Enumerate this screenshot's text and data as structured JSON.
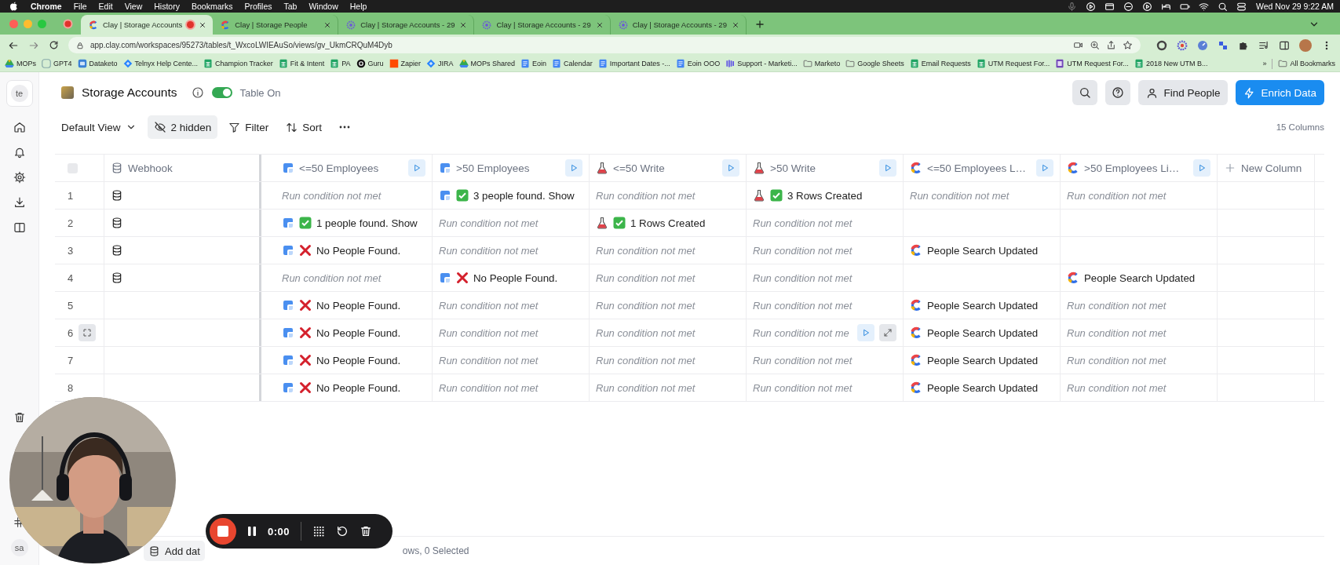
{
  "menu_bar": {
    "items": [
      "Chrome",
      "File",
      "Edit",
      "View",
      "History",
      "Bookmarks",
      "Profiles",
      "Tab",
      "Window",
      "Help"
    ],
    "clock": "Wed Nov 29  9:22 AM"
  },
  "browser_tabs": [
    {
      "title": "Clay | Storage Accounts",
      "kind": "clay",
      "selected": true,
      "recording": true
    },
    {
      "title": "Clay | Storage People",
      "kind": "clay",
      "selected": false,
      "recording": false
    },
    {
      "title": "Clay | Storage Accounts - 29",
      "kind": "gear",
      "selected": false,
      "recording": false
    },
    {
      "title": "Clay | Storage Accounts - 29",
      "kind": "gear",
      "selected": false,
      "recording": false
    },
    {
      "title": "Clay | Storage Accounts - 29",
      "kind": "gear",
      "selected": false,
      "recording": false
    }
  ],
  "address_bar": {
    "url": "app.clay.com/workspaces/95273/tables/t_WxcoLWIEAuSo/views/gv_UkmCRQuM4Dyb"
  },
  "bookmarks": [
    {
      "label": "MOPs",
      "kind": "drive"
    },
    {
      "label": "GPT4",
      "kind": "gpt"
    },
    {
      "label": "Dataketo",
      "kind": "dk"
    },
    {
      "label": "Telnyx Help Cente...",
      "kind": "jira"
    },
    {
      "label": "Champion Tracker",
      "kind": "sheet"
    },
    {
      "label": "Fit & Intent",
      "kind": "sheet"
    },
    {
      "label": "PA",
      "kind": "sheet"
    },
    {
      "label": "Guru",
      "kind": "guru"
    },
    {
      "label": "Zapier",
      "kind": "zapier"
    },
    {
      "label": "JIRA",
      "kind": "jira"
    },
    {
      "label": "MOPs Shared",
      "kind": "drive"
    },
    {
      "label": "Eoin",
      "kind": "doc"
    },
    {
      "label": "Calendar",
      "kind": "doc"
    },
    {
      "label": "Important Dates -...",
      "kind": "doc"
    },
    {
      "label": "Eoin OOO",
      "kind": "doc"
    },
    {
      "label": "Support - Marketi...",
      "kind": "bars"
    },
    {
      "label": "Marketo",
      "kind": "folder"
    },
    {
      "label": "Google Sheets",
      "kind": "folder"
    },
    {
      "label": "Email Requests",
      "kind": "sheet"
    },
    {
      "label": "UTM Request For...",
      "kind": "sheet"
    },
    {
      "label": "UTM Request For...",
      "kind": "form"
    },
    {
      "label": "2018 New UTM B...",
      "kind": "sheet"
    }
  ],
  "bookmarks_more": "»",
  "all_bookmarks": "All Bookmarks",
  "sidebar": {
    "workspace_avatar": "te",
    "user_avatar": "sa"
  },
  "table": {
    "title": "Storage Accounts",
    "toggle": {
      "label": "Table On",
      "on": true
    }
  },
  "header_actions": [
    {
      "label": "Find People",
      "kind": "secondary"
    },
    {
      "label": "Enrich Data",
      "kind": "primary"
    }
  ],
  "view_bar": {
    "view": "Default View",
    "hidden": "2 hidden",
    "filter": "Filter",
    "sort": "Sort",
    "column_count": "15 Columns"
  },
  "select_all": {
    "checked": false
  },
  "columns": [
    {
      "title": "Webhook",
      "kind": "webhook",
      "run_button": false
    },
    {
      "title": "<=50 Employees",
      "kind": "people",
      "run_button": true
    },
    {
      "title": ">50 Employees",
      "kind": "people",
      "run_button": true
    },
    {
      "title": "<=50 Write",
      "kind": "write",
      "run_button": true
    },
    {
      "title": ">50 Write",
      "kind": "write",
      "run_button": true
    },
    {
      "title": "<=50 Employees L…",
      "kind": "lookup",
      "run_button": true
    },
    {
      "title": ">50 Employees Li…",
      "kind": "lookup",
      "run_button": true
    },
    {
      "title": "New Column",
      "kind": "add",
      "run_button": false
    }
  ],
  "rows": [
    {
      "number": "1",
      "hovered": false,
      "cells": [
        {
          "kind": "record"
        },
        {
          "kind": "muted",
          "text": "Run condition not met"
        },
        {
          "kind": "people_found",
          "text": "3 people found. Show"
        },
        {
          "kind": "muted",
          "text": "Run condition not met"
        },
        {
          "kind": "rows_created",
          "text": "3 Rows Created"
        },
        {
          "kind": "muted",
          "text": "Run condition not met"
        },
        {
          "kind": "muted",
          "text": "Run condition not met"
        }
      ]
    },
    {
      "number": "2",
      "hovered": false,
      "cells": [
        {
          "kind": "record"
        },
        {
          "kind": "people_found",
          "text": "1 people found. Show"
        },
        {
          "kind": "muted",
          "text": "Run condition not met"
        },
        {
          "kind": "rows_created",
          "text": "1 Rows Created"
        },
        {
          "kind": "muted",
          "text": "Run condition not met"
        },
        {
          "kind": "empty"
        },
        {
          "kind": "empty"
        }
      ]
    },
    {
      "number": "3",
      "hovered": false,
      "cells": [
        {
          "kind": "record"
        },
        {
          "kind": "no_people",
          "text": "No People Found."
        },
        {
          "kind": "muted",
          "text": "Run condition not met"
        },
        {
          "kind": "muted",
          "text": "Run condition not met"
        },
        {
          "kind": "muted",
          "text": "Run condition not met"
        },
        {
          "kind": "search_updated",
          "text": "People Search Updated"
        },
        {
          "kind": "empty"
        }
      ]
    },
    {
      "number": "4",
      "hovered": false,
      "cells": [
        {
          "kind": "record"
        },
        {
          "kind": "muted",
          "text": "Run condition not met"
        },
        {
          "kind": "no_people",
          "text": "No People Found."
        },
        {
          "kind": "muted",
          "text": "Run condition not met"
        },
        {
          "kind": "muted",
          "text": "Run condition not met"
        },
        {
          "kind": "empty"
        },
        {
          "kind": "search_updated",
          "text": "People Search Updated"
        }
      ]
    },
    {
      "number": "5",
      "hovered": false,
      "cells": [
        {
          "kind": "empty"
        },
        {
          "kind": "no_people",
          "text": "No People Found."
        },
        {
          "kind": "muted",
          "text": "Run condition not met"
        },
        {
          "kind": "muted",
          "text": "Run condition not met"
        },
        {
          "kind": "muted",
          "text": "Run condition not met"
        },
        {
          "kind": "search_updated",
          "text": "People Search Updated"
        },
        {
          "kind": "muted",
          "text": "Run condition not met"
        }
      ]
    },
    {
      "number": "6",
      "hovered": true,
      "cells": [
        {
          "kind": "empty"
        },
        {
          "kind": "no_people",
          "text": "No People Found."
        },
        {
          "kind": "muted",
          "text": "Run condition not met"
        },
        {
          "kind": "muted",
          "text": "Run condition not met"
        },
        {
          "kind": "muted",
          "text": "Run condition not me",
          "hover": true
        },
        {
          "kind": "search_updated",
          "text": "People Search Updated"
        },
        {
          "kind": "muted",
          "text": "Run condition not met"
        }
      ]
    },
    {
      "number": "7",
      "hovered": false,
      "cells": [
        {
          "kind": "empty"
        },
        {
          "kind": "no_people",
          "text": "No People Found."
        },
        {
          "kind": "muted",
          "text": "Run condition not met"
        },
        {
          "kind": "muted",
          "text": "Run condition not met"
        },
        {
          "kind": "muted",
          "text": "Run condition not met"
        },
        {
          "kind": "search_updated",
          "text": "People Search Updated"
        },
        {
          "kind": "muted",
          "text": "Run condition not met"
        }
      ]
    },
    {
      "number": "8",
      "hovered": false,
      "cells": [
        {
          "kind": "empty"
        },
        {
          "kind": "no_people",
          "text": "No People Found."
        },
        {
          "kind": "muted",
          "text": "Run condition not met"
        },
        {
          "kind": "muted",
          "text": "Run condition not met"
        },
        {
          "kind": "muted",
          "text": "Run condition not met"
        },
        {
          "kind": "search_updated",
          "text": "People Search Updated"
        },
        {
          "kind": "muted",
          "text": "Run condition not met"
        }
      ]
    }
  ],
  "footer": {
    "add_data": "Add dat",
    "status": "ows, 0 Selected"
  },
  "recorder": {
    "time": "0:00"
  }
}
